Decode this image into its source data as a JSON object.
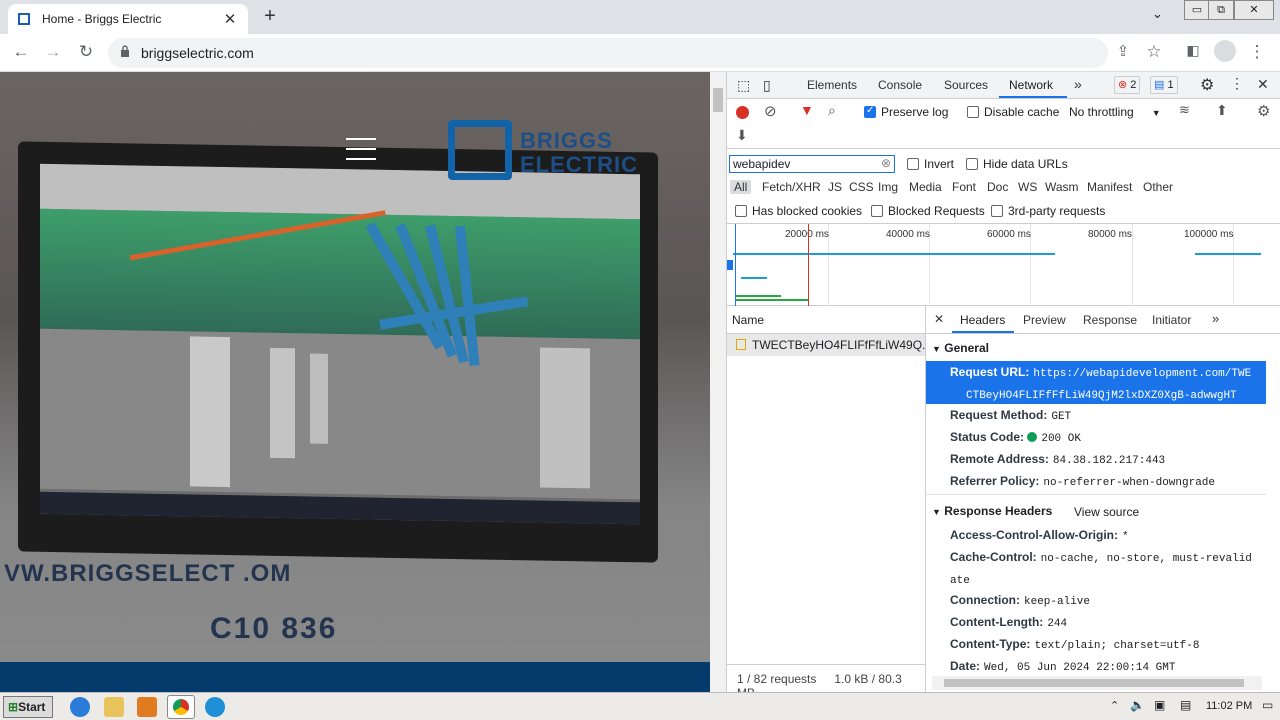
{
  "browser": {
    "tab_title": "Home - Briggs Electric",
    "url": "briggselectric.com",
    "win_min": "▭",
    "win_max": "⧉",
    "win_close": "✕"
  },
  "page": {
    "brand_top": "BRIGGS",
    "brand_bottom": "ELECTRIC",
    "wall_text": "VW.BRIGGSELECT    .OM",
    "phone_text": "C10   836"
  },
  "devtools": {
    "tabs": [
      "Elements",
      "Console",
      "Sources",
      "Network"
    ],
    "more": "»",
    "errors": "2",
    "messages": "1",
    "preserve_log": "Preserve log",
    "disable_cache": "Disable cache",
    "throttling": "No throttling",
    "filter_value": "webapidev",
    "invert": "Invert",
    "hide_data_urls": "Hide data URLs",
    "types": [
      "All",
      "Fetch/XHR",
      "JS",
      "CSS",
      "Img",
      "Media",
      "Font",
      "Doc",
      "WS",
      "Wasm",
      "Manifest",
      "Other"
    ],
    "has_blocked_cookies": "Has blocked cookies",
    "blocked_requests": "Blocked Requests",
    "third_party": "3rd-party requests",
    "ticks": [
      "20000 ms",
      "40000 ms",
      "60000 ms",
      "80000 ms",
      "100000 ms"
    ],
    "name_header": "Name",
    "request_name": "TWECTBeyHO4FLIFfFfLiW49Q...",
    "summary_requests": "1 / 82 requests",
    "summary_size": "1.0 kB / 80.3 MB",
    "detail_tabs": [
      "Headers",
      "Preview",
      "Response",
      "Initiator"
    ],
    "general": "General",
    "request_url_label": "Request URL:",
    "request_url_1": "https://webapidevelopment.com/TWE",
    "request_url_2": "CTBeyHO4FLIFfFfLiW49QjM2lxDXZ0XgB-adwwgHT",
    "request_method_label": "Request Method:",
    "request_method": "GET",
    "status_code_label": "Status Code:",
    "status_code": "200 OK",
    "remote_address_label": "Remote Address:",
    "remote_address": "84.38.182.217:443",
    "referrer_policy_label": "Referrer Policy:",
    "referrer_policy": "no-referrer-when-downgrade",
    "response_headers": "Response Headers",
    "view_source": "View source",
    "acao_label": "Access-Control-Allow-Origin:",
    "acao": "*",
    "cache_label": "Cache-Control:",
    "cache_1": "no-cache, no-store, must-revalid",
    "cache_2": "ate",
    "connection_label": "Connection:",
    "connection": "keep-alive",
    "length_label": "Content-Length:",
    "length": "244",
    "type_label": "Content-Type:",
    "type": "text/plain; charset=utf-8",
    "date_label": "Date:",
    "date": "Wed, 05 Jun 2024 22:00:14 GMT"
  },
  "taskbar": {
    "start": "Start",
    "clock": "11:02 PM"
  },
  "colors": {
    "accent": "#1a73e8",
    "brand": "#1363a8",
    "status_ok": "#0f9d58",
    "record": "#d93025"
  }
}
